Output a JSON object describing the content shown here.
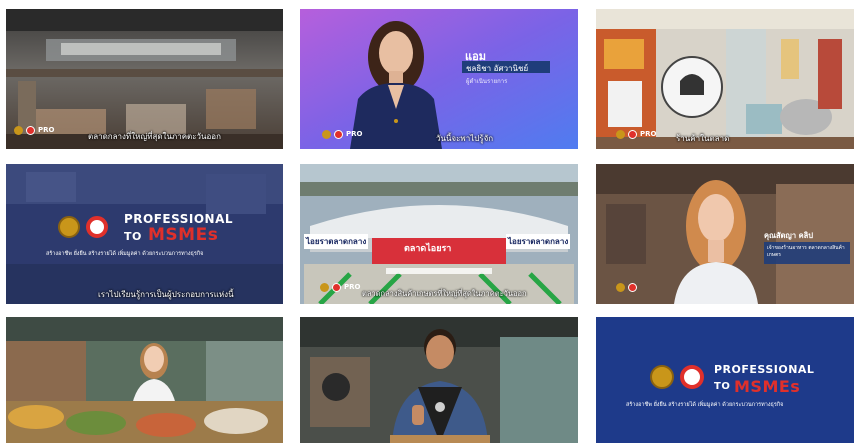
{
  "tiles": [
    {
      "name": "market-hall",
      "caption": "ตลาดกลางที่ใหญ่ที่สุดในภาคตะวันออก"
    },
    {
      "name": "presenter-studio",
      "host_nickname": "แอม",
      "host_fullname": "ชลธิชา อัศวานิชย์",
      "host_sub": "ผู้ดำเนินรายการ",
      "caption": "วันนี้จะพาไปรู้จัก"
    },
    {
      "name": "food-stall",
      "caption": "ร้านค้าในตลาด"
    },
    {
      "name": "title-card-street",
      "title_top": "Professional",
      "title_to": "TO",
      "title_main": "MSMEs",
      "subtitle": "สร้างอาชีพ ยั่งยืน สร้างรายได้ เพิ่มมูลค่า ด้วยกระบวนการทางธุรกิจ",
      "caption": "เราไปเรียนรู้การเป็นผู้ประกอบการแห่งนี้"
    },
    {
      "name": "market-aerial",
      "sign_left": "ไอยราตลาดกลาง",
      "sign_center": "ตลาดไอยรา",
      "sign_right": "ไอยราตลาดกลาง",
      "caption": "ตลาดกลางสินค้าเกษตรที่ใหญ่ที่สุดในภาคตะวันออก"
    },
    {
      "name": "interview-woman",
      "name_label": "คุณสัตญา คลิป",
      "role_label": "เจ้าของร้านอาหาร ตลาดกลางสินค้าเกษตร"
    },
    {
      "name": "food-vendor-woman"
    },
    {
      "name": "vendor-thumbs-up"
    },
    {
      "name": "title-card-blue",
      "title_top": "Professional",
      "title_to": "TO",
      "title_main": "MSMEs",
      "subtitle": "สร้างอาชีพ ยั่งยืน สร้างรายได้ เพิ่มมูลค่า ด้วยกระบวนการทางธุรกิจ"
    }
  ],
  "colors": {
    "brand_red": "#e0302b",
    "brand_blue": "#1e3a8a",
    "gold": "#c9961a"
  }
}
